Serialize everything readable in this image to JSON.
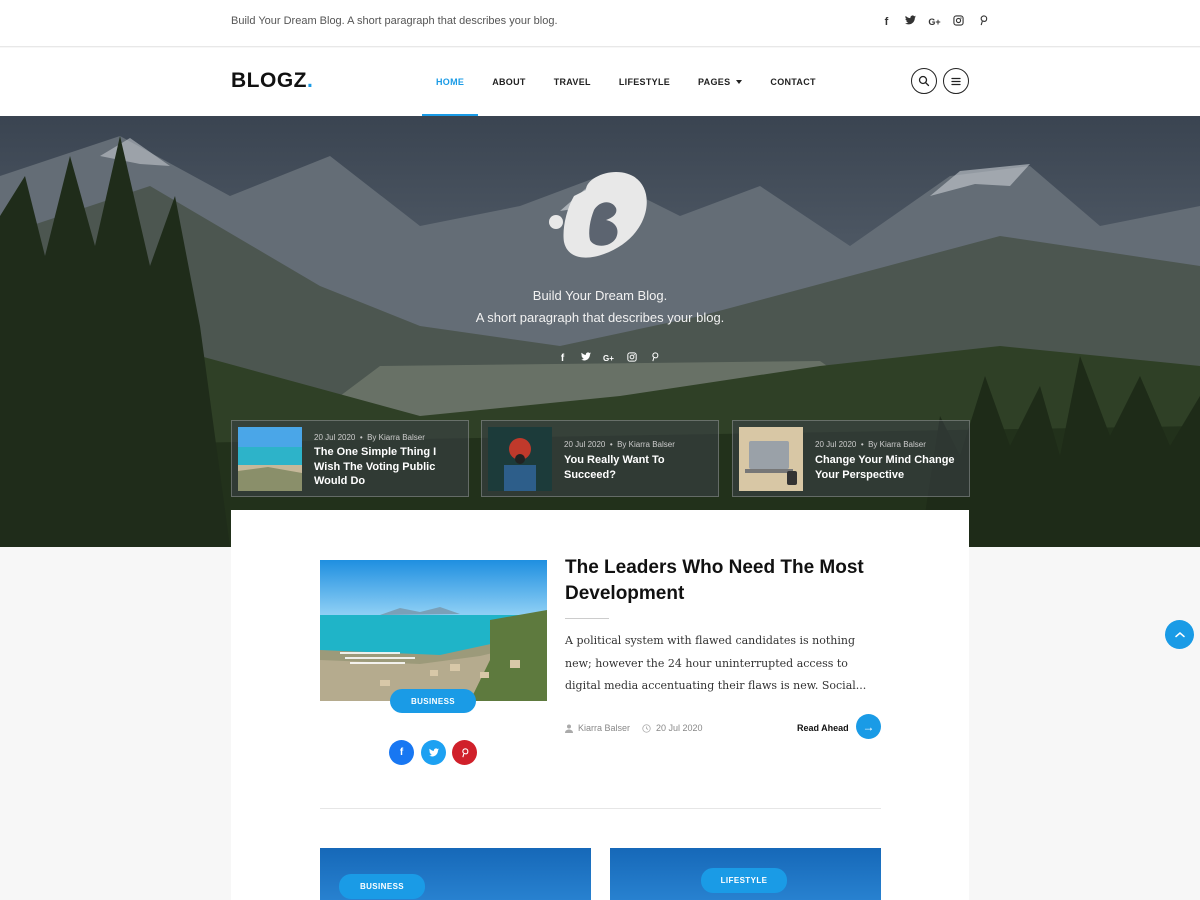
{
  "topbar": {
    "tagline": "Build Your Dream Blog. A short paragraph that describes your blog.",
    "socials": [
      "facebook-icon",
      "twitter-icon",
      "google-plus-icon",
      "instagram-icon",
      "pinterest-icon"
    ]
  },
  "header": {
    "logo_text": "BLOGZ",
    "logo_dot": ".",
    "nav": [
      {
        "label": "HOME",
        "active": true
      },
      {
        "label": "ABOUT"
      },
      {
        "label": "TRAVEL"
      },
      {
        "label": "LIFESTYLE"
      },
      {
        "label": "PAGES",
        "dropdown": true
      },
      {
        "label": "CONTACT"
      }
    ],
    "buttons": [
      "search-icon",
      "menu-icon"
    ]
  },
  "hero": {
    "line1": "Build Your Dream Blog.",
    "line2": "A short paragraph that describes your blog.",
    "featured": [
      {
        "date": "20 Jul 2020",
        "author": "By Kiarra Balser",
        "title": "The One Simple Thing I Wish The Voting Public Would Do"
      },
      {
        "date": "20 Jul 2020",
        "author": "By Kiarra Balser",
        "title": "You Really Want To Succeed?"
      },
      {
        "date": "20 Jul 2020",
        "author": "By Kiarra Balser",
        "title": "Change Your Mind Change Your Perspective"
      }
    ]
  },
  "post": {
    "category": "BUSINESS",
    "title": "The Leaders Who Need The Most Development",
    "excerpt": "A political system with flawed candidates is nothing new; however the 24 hour uninterrupted access to digital media accentuating their flaws is new. Social...",
    "author": "Kiarra Balser",
    "date": "20 Jul 2020",
    "read_more": "Read Ahead"
  },
  "next_posts": [
    {
      "category": "BUSINESS"
    },
    {
      "category": "LIFESTYLE"
    }
  ],
  "colors": {
    "accent": "#1a9be6",
    "facebook": "#1877f2",
    "twitter": "#1da1f2",
    "pinterest": "#d0202a"
  }
}
